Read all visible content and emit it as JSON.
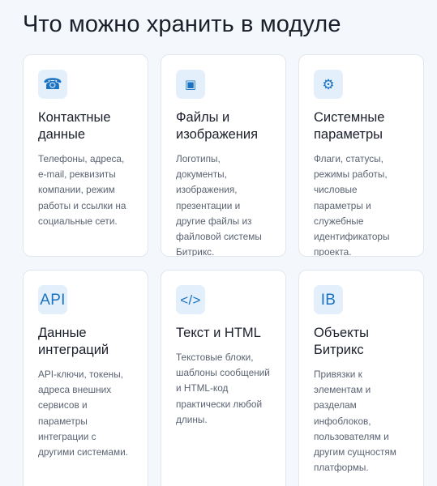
{
  "page": {
    "title": "Что можно хранить в модуле"
  },
  "cards": [
    {
      "icon": "phone-icon",
      "glyph": "☎",
      "title": "Контактные данные",
      "desc": "Телефоны, адреса, e-mail, реквизиты компании, режим работы и ссылки на социальные сети."
    },
    {
      "icon": "file-icon",
      "glyph": "▣",
      "title": "Файлы и изображения",
      "desc": "Логотипы, документы, изображения, презентации и другие файлы из файловой системы Битрикс."
    },
    {
      "icon": "gear-icon",
      "glyph": "⚙",
      "title": "Системные параметры",
      "desc": "Флаги, статусы, режимы работы, числовые параметры и служебные идентификаторы проекта."
    },
    {
      "icon": "api-icon",
      "glyph": "API",
      "title": "Данные интеграций",
      "desc": "API-ключи, токены, адреса внешних сервисов и параметры интеграции с другими системами."
    },
    {
      "icon": "code-icon",
      "glyph": "</>",
      "title": "Текст и HTML",
      "desc": "Текстовые блоки, шаблоны сообщений и HTML-код практически любой длины."
    },
    {
      "icon": "ib-icon",
      "glyph": "IB",
      "title": "Объекты Битрикс",
      "desc": "Привязки к элементам и разделам инфоблоков, пользователям и другим сущностям платформы."
    }
  ],
  "colors": {
    "accent": "#1a73c2",
    "icon_bg": "#e3f0fb",
    "card_border": "#e1e7ef",
    "background": "#f4f7fb"
  }
}
